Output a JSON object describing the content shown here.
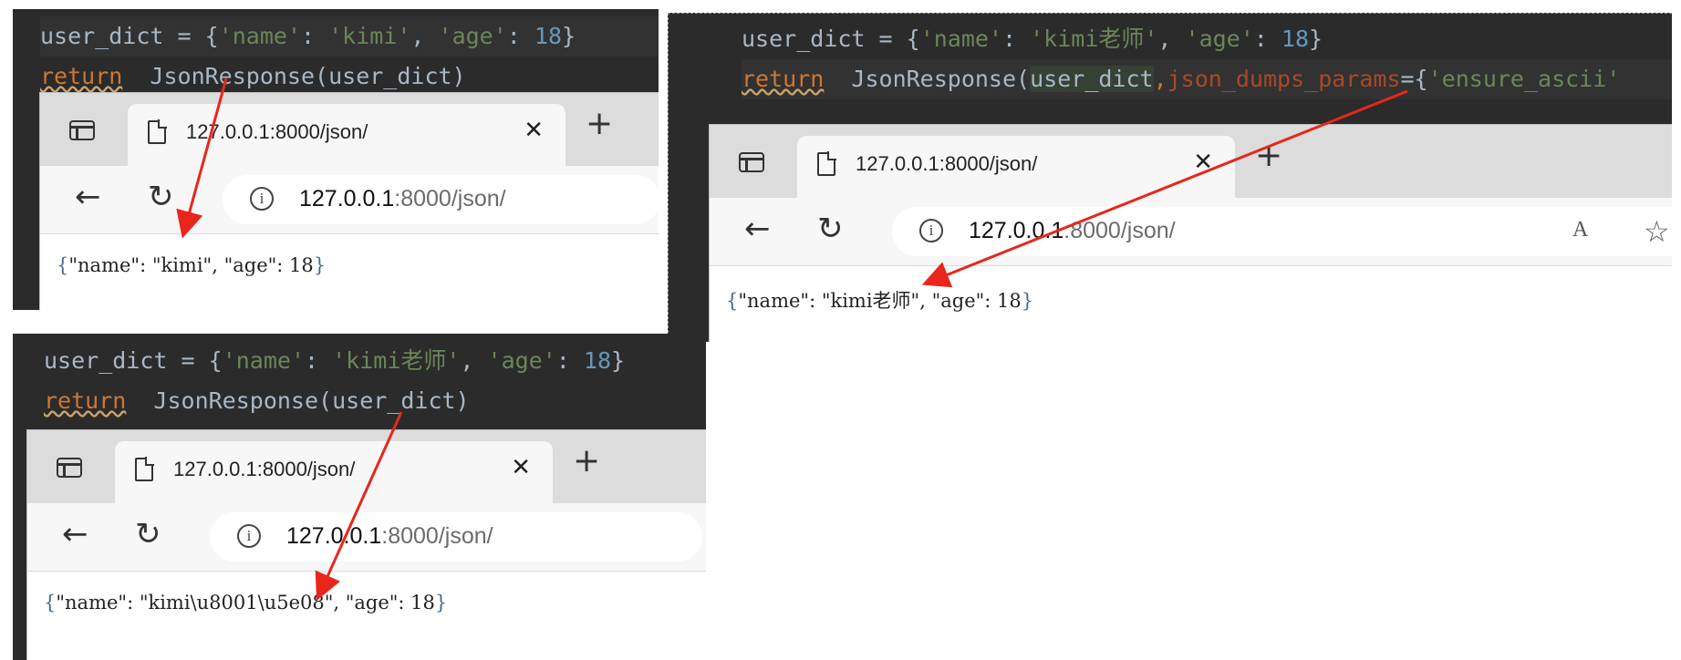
{
  "panel_top_left": {
    "code_lines": [
      {
        "var": "user_dict",
        "op": " = {",
        "k1": "'name'",
        "c1": ": ",
        "v1": "'kimi'",
        "c2": ", ",
        "k2": "'age'",
        "c3": ": ",
        "n": "18",
        "end": "}"
      },
      {
        "kw": "return",
        "fn": "JsonResponse(user_dict)"
      }
    ],
    "browser": {
      "tab_title": "127.0.0.1:8000/json/",
      "close_glyph": "✕",
      "new_tab_glyph": "+",
      "address_host": "127.0.0.1",
      "address_rest": ":8000/json/",
      "content_json": "\"name\": \"kimi\", \"age\": 18"
    }
  },
  "panel_right": {
    "code_lines": [
      {
        "var": "user_dict",
        "op": " = {",
        "k1": "'name'",
        "c1": ": ",
        "v1": "'kimi老师'",
        "c2": ", ",
        "k2": "'age'",
        "c3": ": ",
        "n": "18",
        "end": "}"
      },
      {
        "kw": "return",
        "fn1": "JsonResponse(",
        "arg": "user_dict",
        "comma": ",",
        "param": "json_dumps_params",
        "eq": "={",
        "str": "'ensure_ascii'"
      }
    ],
    "browser": {
      "tab_title": "127.0.0.1:8000/json/",
      "close_glyph": "✕",
      "new_tab_glyph": "+",
      "address_host": "127.0.0.1",
      "address_rest": ":8000/json/",
      "read_aloud_glyph": "A",
      "favorite_glyph": "☆",
      "content_json": "\"name\": \"kimi老师\", \"age\": 18"
    }
  },
  "panel_bottom_left": {
    "code_lines": [
      {
        "var": "user_dict",
        "op": " = {",
        "k1": "'name'",
        "c1": ": ",
        "v1": "'kimi老师'",
        "c2": ", ",
        "k2": "'age'",
        "c3": ": ",
        "n": "18",
        "end": "}"
      },
      {
        "kw": "return",
        "fn": "JsonResponse(user_dict)"
      }
    ],
    "browser": {
      "tab_title": "127.0.0.1:8000/json/",
      "close_glyph": "✕",
      "new_tab_glyph": "+",
      "address_host": "127.0.0.1",
      "address_rest": ":8000/json/",
      "content_json": "\"name\": \"kimi\\u8001\\u5e08\", \"age\": 18"
    }
  },
  "colors": {
    "editor_bg": "#2b2b2b",
    "keyword": "#cc7832",
    "string": "#6a8759",
    "number": "#6897bb",
    "param": "#aa4926",
    "arrow": "#e8261c"
  }
}
